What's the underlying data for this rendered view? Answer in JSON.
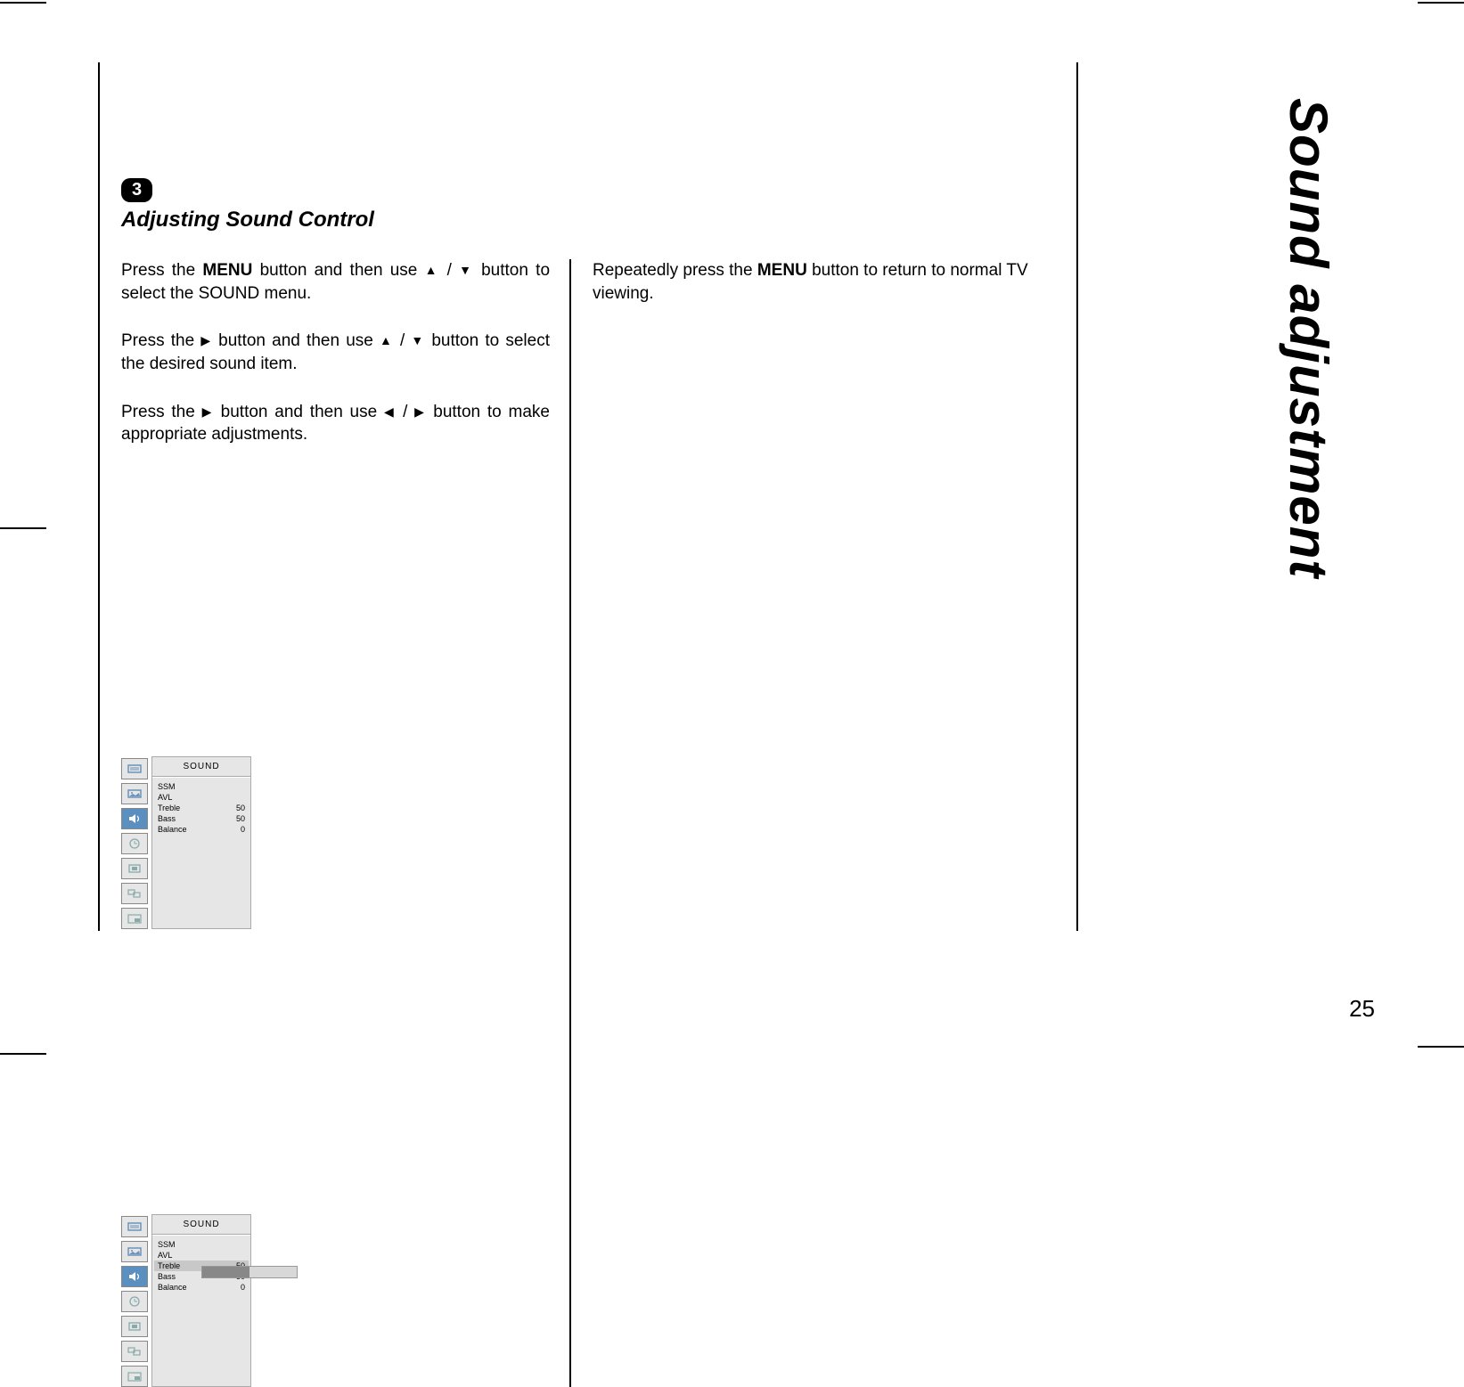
{
  "side_title": "Sound adjustment",
  "page_number": "25",
  "step_number": "3",
  "section_title": "Adjusting Sound Control",
  "para1_a": "Press the ",
  "para1_menu": "MENU",
  "para1_b": " button and then use ",
  "para1_c": " button to select the SOUND menu.",
  "para2_a": "Press the ",
  "para2_b": " button and then use ",
  "para2_c": " button to select the desired sound item.",
  "para3_a": "Press the ",
  "para3_b": " button and then use ",
  "para3_c": " button to make appropriate adjustments.",
  "para4_a": "Repeatedly press the ",
  "para4_menu": "MENU",
  "para4_b": " button to return to normal TV viewing.",
  "menu": {
    "title": "SOUND",
    "items": [
      {
        "label": "SSM",
        "value": ""
      },
      {
        "label": "AVL",
        "value": ""
      },
      {
        "label": "Treble",
        "value": "50"
      },
      {
        "label": "Bass",
        "value": "50"
      },
      {
        "label": "Balance",
        "value": "0"
      }
    ]
  }
}
